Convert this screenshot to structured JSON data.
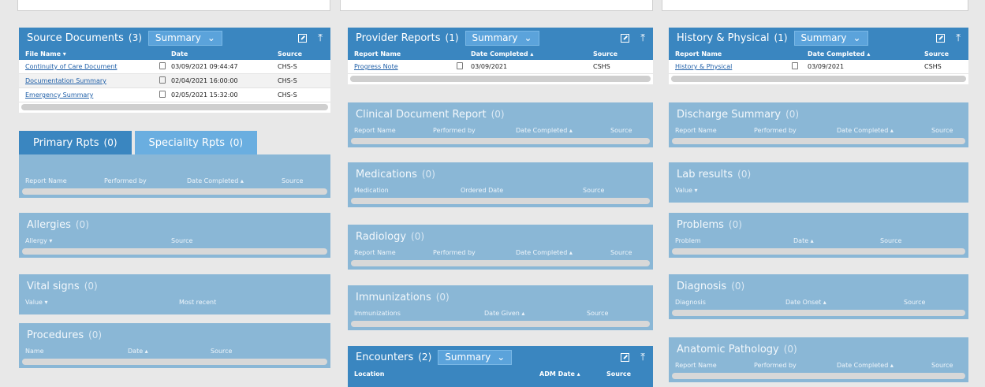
{
  "icons": {
    "open": "external-window-icon",
    "collapse": "collapse-up-icon",
    "doc": "document-icon",
    "chevron": "chevron-down-icon"
  },
  "colors": {
    "header_dark": "#3a86c0",
    "header_light": "#8ab7d6",
    "link": "#1f5fa8"
  },
  "source_documents": {
    "title": "Source Documents",
    "count": "(3)",
    "summary": "Summary",
    "cols": [
      "File Name ▾",
      "Date",
      "Source"
    ],
    "rows": [
      {
        "name": "Continuity of Care Document",
        "date": "03/09/2021 09:44:47",
        "source": "CHS-S"
      },
      {
        "name": "Documentation Summary",
        "date": "02/04/2021 16:00:00",
        "source": "CHS-S"
      },
      {
        "name": "Emergency Summary",
        "date": "02/05/2021 15:32:00",
        "source": "CHS-S"
      }
    ]
  },
  "tabs": {
    "primary": {
      "label": "Primary Rpts",
      "count": "(0)"
    },
    "speciality": {
      "label": "Speciality Rpts",
      "count": "(0)"
    },
    "cols": [
      "Report Name",
      "Performed by",
      "Date Completed ▴",
      "Source"
    ]
  },
  "allergies": {
    "title": "Allergies",
    "count": "(0)",
    "cols": [
      "Allergy ▾",
      "Source"
    ]
  },
  "vital_signs": {
    "title": "Vital signs",
    "count": "(0)",
    "cols": [
      "Value ▾",
      "Most recent"
    ]
  },
  "procedures": {
    "title": "Procedures",
    "count": "(0)",
    "cols": [
      "Name",
      "Date ▴",
      "Source"
    ]
  },
  "provider_reports": {
    "title": "Provider Reports",
    "count": "(1)",
    "summary": "Summary",
    "cols": [
      "Report Name",
      "Date Completed ▴",
      "Source"
    ],
    "rows": [
      {
        "name": "Progress Note",
        "date": "03/09/2021",
        "source": "CSHS"
      }
    ]
  },
  "clinical_document": {
    "title": "Clinical Document Report",
    "count": "(0)",
    "cols": [
      "Report Name",
      "Performed by",
      "Date Completed ▴",
      "Source"
    ]
  },
  "medications": {
    "title": "Medications",
    "count": "(0)",
    "cols": [
      "Medication",
      "Ordered Date",
      "Source"
    ]
  },
  "radiology": {
    "title": "Radiology",
    "count": "(0)",
    "cols": [
      "Report Name",
      "Performed by",
      "Date Completed ▴",
      "Source"
    ]
  },
  "immunizations": {
    "title": "Immunizations",
    "count": "(0)",
    "cols": [
      "Immunizations",
      "Date Given ▴",
      "Source"
    ]
  },
  "encounters": {
    "title": "Encounters",
    "count": "(2)",
    "summary": "Summary",
    "cols": [
      "Location",
      "ADM Date ▴",
      "Source"
    ]
  },
  "history_physical": {
    "title": "History & Physical",
    "count": "(1)",
    "summary": "Summary",
    "cols": [
      "Report Name",
      "Date Completed ▴",
      "Source"
    ],
    "rows": [
      {
        "name": "History & Physical",
        "date": "03/09/2021",
        "source": "CSHS"
      }
    ]
  },
  "discharge_summary": {
    "title": "Discharge Summary",
    "count": "(0)",
    "cols": [
      "Report Name",
      "Performed by",
      "Date Completed ▴",
      "Source"
    ]
  },
  "lab_results": {
    "title": "Lab results",
    "count": "(0)",
    "cols": [
      "Value ▾"
    ]
  },
  "problems": {
    "title": "Problems",
    "count": "(0)",
    "cols": [
      "Problem",
      "Date ▴",
      "Source"
    ]
  },
  "diagnosis": {
    "title": "Diagnosis",
    "count": "(0)",
    "cols": [
      "Diagnosis",
      "Date Onset ▴",
      "Source"
    ]
  },
  "anatomic_pathology": {
    "title": "Anatomic Pathology",
    "count": "(0)",
    "cols": [
      "Report Name",
      "Performed by",
      "Date Completed ▴",
      "Source"
    ]
  }
}
